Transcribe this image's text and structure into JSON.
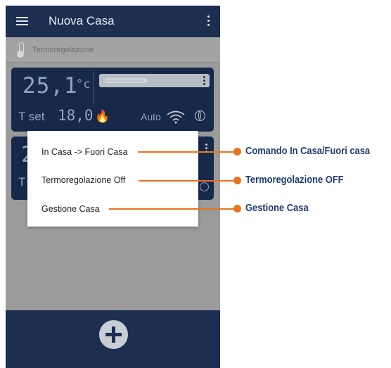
{
  "app": {
    "title": "Nuova Casa",
    "section_label": "Termoregolazione"
  },
  "card1": {
    "temperature": "25,1",
    "unit": "°c",
    "tset_label": "T set",
    "tset_value": "18,0",
    "mode": "Auto"
  },
  "card2": {
    "temperature_partial": "2",
    "tset_label_partial": "T"
  },
  "popup_menu": {
    "items": [
      {
        "label": "In Casa -> Fuori Casa"
      },
      {
        "label": "Termoregolazione Off"
      },
      {
        "label": "Gestione Casa"
      }
    ]
  },
  "callouts": [
    {
      "label": "Comando In Casa/Fuori casa"
    },
    {
      "label": "Termoregolazione OFF"
    },
    {
      "label": "Gestione Casa"
    }
  ],
  "colors": {
    "appbar": "#1c2f51",
    "card": "#17294a",
    "accent_orange": "#e8741f",
    "callout_text": "#1f3a75"
  },
  "icons": [
    "menu-icon",
    "kebab-menu-icon",
    "thermometer-icon",
    "flame-icon",
    "wifi-icon",
    "globe-icon",
    "plus-icon"
  ]
}
